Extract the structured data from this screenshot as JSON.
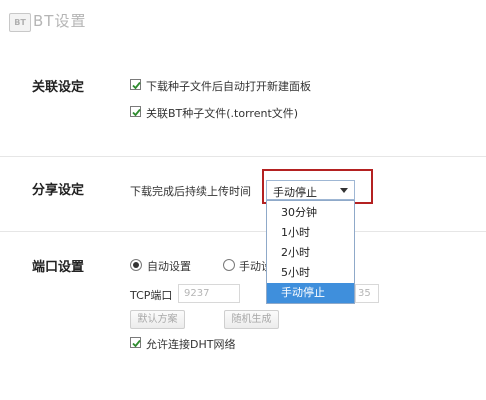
{
  "header": {
    "icon_text": "BT",
    "title": "BT设置"
  },
  "association": {
    "title": "关联设定",
    "options": [
      {
        "label": "下载种子文件后自动打开新建面板",
        "checked": true
      },
      {
        "label": "关联BT种子文件(.torrent文件)",
        "checked": true
      }
    ]
  },
  "sharing": {
    "title": "分享设定",
    "seed_label": "下载完成后持续上传时间",
    "selected": "手动停止",
    "options": [
      "30分钟",
      "1小时",
      "2小时",
      "5小时",
      "手动停止"
    ],
    "highlight_color": "#b42121"
  },
  "port": {
    "title": "端口设置",
    "auto_label": "自动设置",
    "manual_label": "手动设",
    "mode": "auto",
    "tcp_label": "TCP端口",
    "tcp_value": "9237",
    "udp_fragment": "35",
    "default_button": "默认方案",
    "random_button": "随机生成",
    "dht_label": "允许连接DHT网络",
    "dht_checked": true
  },
  "colors": {
    "accent_selected": "#3f8fdc",
    "check_mark": "#2e8b2e"
  }
}
